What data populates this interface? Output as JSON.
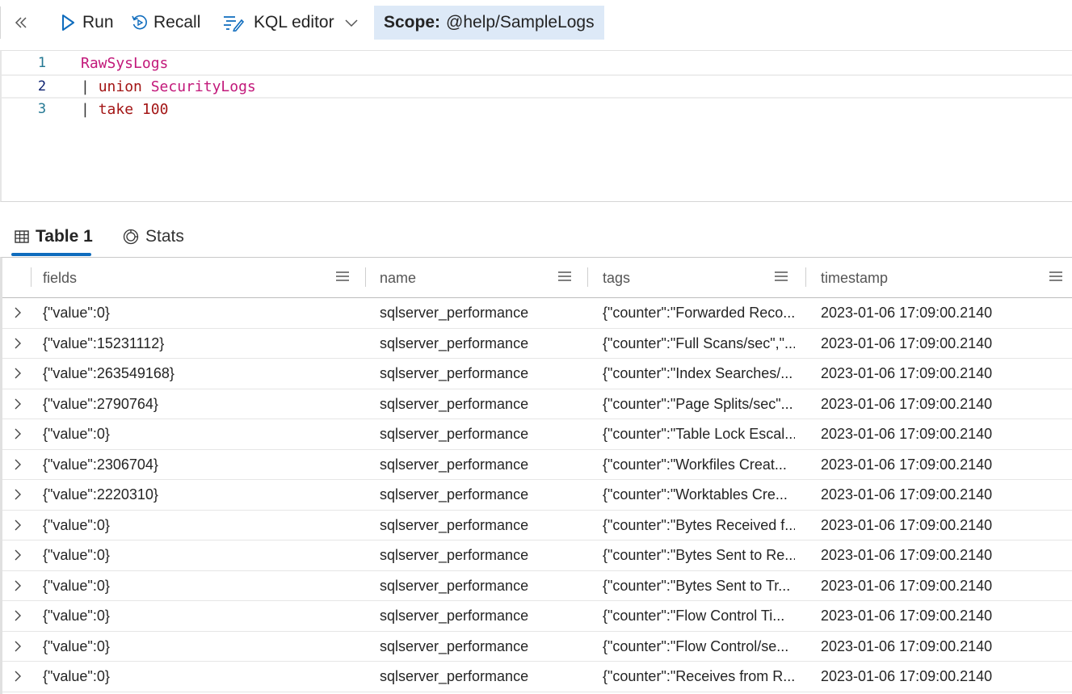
{
  "toolbar": {
    "collapse_icon": "double-chevron-left-icon",
    "run_label": "Run",
    "recall_label": "Recall",
    "kql_label": "KQL editor",
    "scope_label": "Scope:",
    "scope_value": "@help/SampleLogs"
  },
  "editor": {
    "lines": [
      {
        "number": "1",
        "parts": [
          "RawSysLogs"
        ]
      },
      {
        "number": "2",
        "parts": [
          "|",
          "union",
          "SecurityLogs"
        ]
      },
      {
        "number": "3",
        "parts": [
          "|",
          "take",
          "100"
        ]
      }
    ]
  },
  "tabs": [
    {
      "label": "Table 1",
      "icon": "table-icon",
      "selected": true
    },
    {
      "label": "Stats",
      "icon": "stats-icon",
      "selected": false
    }
  ],
  "grid": {
    "columns": [
      "fields",
      "name",
      "tags",
      "timestamp"
    ],
    "rows": [
      [
        "{\"value\":0}",
        "sqlserver_performance",
        "{\"counter\":\"Forwarded Reco...",
        "2023-01-06 17:09:00.2140"
      ],
      [
        "{\"value\":15231112}",
        "sqlserver_performance",
        "{\"counter\":\"Full Scans/sec\",\"...",
        "2023-01-06 17:09:00.2140"
      ],
      [
        "{\"value\":263549168}",
        "sqlserver_performance",
        "{\"counter\":\"Index Searches/...",
        "2023-01-06 17:09:00.2140"
      ],
      [
        "{\"value\":2790764}",
        "sqlserver_performance",
        "{\"counter\":\"Page Splits/sec\"...",
        "2023-01-06 17:09:00.2140"
      ],
      [
        "{\"value\":0}",
        "sqlserver_performance",
        "{\"counter\":\"Table Lock Escal...",
        "2023-01-06 17:09:00.2140"
      ],
      [
        "{\"value\":2306704}",
        "sqlserver_performance",
        "{\"counter\":\"Workfiles Creat...",
        "2023-01-06 17:09:00.2140"
      ],
      [
        "{\"value\":2220310}",
        "sqlserver_performance",
        "{\"counter\":\"Worktables Cre...",
        "2023-01-06 17:09:00.2140"
      ],
      [
        "{\"value\":0}",
        "sqlserver_performance",
        "{\"counter\":\"Bytes Received f...",
        "2023-01-06 17:09:00.2140"
      ],
      [
        "{\"value\":0}",
        "sqlserver_performance",
        "{\"counter\":\"Bytes Sent to Re...",
        "2023-01-06 17:09:00.2140"
      ],
      [
        "{\"value\":0}",
        "sqlserver_performance",
        "{\"counter\":\"Bytes Sent to Tr...",
        "2023-01-06 17:09:00.2140"
      ],
      [
        "{\"value\":0}",
        "sqlserver_performance",
        "{\"counter\":\"Flow Control Ti...",
        "2023-01-06 17:09:00.2140"
      ],
      [
        "{\"value\":0}",
        "sqlserver_performance",
        "{\"counter\":\"Flow Control/se...",
        "2023-01-06 17:09:00.2140"
      ],
      [
        "{\"value\":0}",
        "sqlserver_performance",
        "{\"counter\":\"Receives from R...",
        "2023-01-06 17:09:00.2140"
      ]
    ]
  },
  "colors": {
    "accent": "#0f6cbd",
    "scope_bg": "#dde9f7",
    "kql_keyword": "#a31515",
    "kql_table": "#c2187a",
    "line_number": "#237893"
  }
}
